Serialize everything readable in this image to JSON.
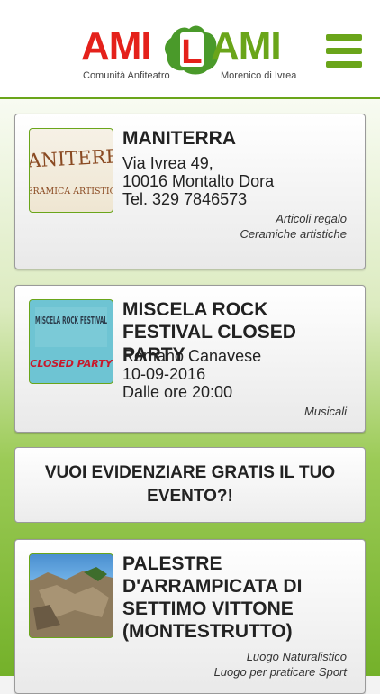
{
  "header": {
    "logo_left": "AMI",
    "logo_middle": "L",
    "logo_right": "AMI",
    "logo_sub_left": "Comunità Anfiteatro",
    "logo_sub_right": "Morenico di Ivrea",
    "menu_icon": "hamburger-menu-icon"
  },
  "colors": {
    "brand_red": "#e4211b",
    "brand_green": "#6aa51a"
  },
  "listings": [
    {
      "title": "MANITERRA",
      "image_text_top": "MANITERRA",
      "image_text_bottom": "CERAMICA ARTISTICA",
      "details": [
        "Via Ivrea 49,",
        "10016 Montalto Dora",
        "Tel. 329 7846573"
      ],
      "categories": [
        "Articoli regalo",
        "Ceramiche artistiche"
      ]
    },
    {
      "title": "MISCELA ROCK FESTIVAL CLOSED PARTY",
      "image_text_top": "MISCELA ROCK FESTIVAL",
      "image_text_bottom": "CLOSED PARTY",
      "details": [
        "Romano Canavese",
        "10-09-2016",
        "Dalle ore 20:00"
      ],
      "categories": [
        "Musicali"
      ]
    },
    {
      "title": "PALESTRE D'ARRAMPICATA DI SETTIMO VITTONE (MONTESTRUTTO)",
      "details": [],
      "categories": [
        "Luogo Naturalistico",
        "Luogo per praticare Sport"
      ]
    }
  ],
  "promo": {
    "label": "VUOI EVIDENZIARE GRATIS IL TUO EVENTO?!"
  }
}
